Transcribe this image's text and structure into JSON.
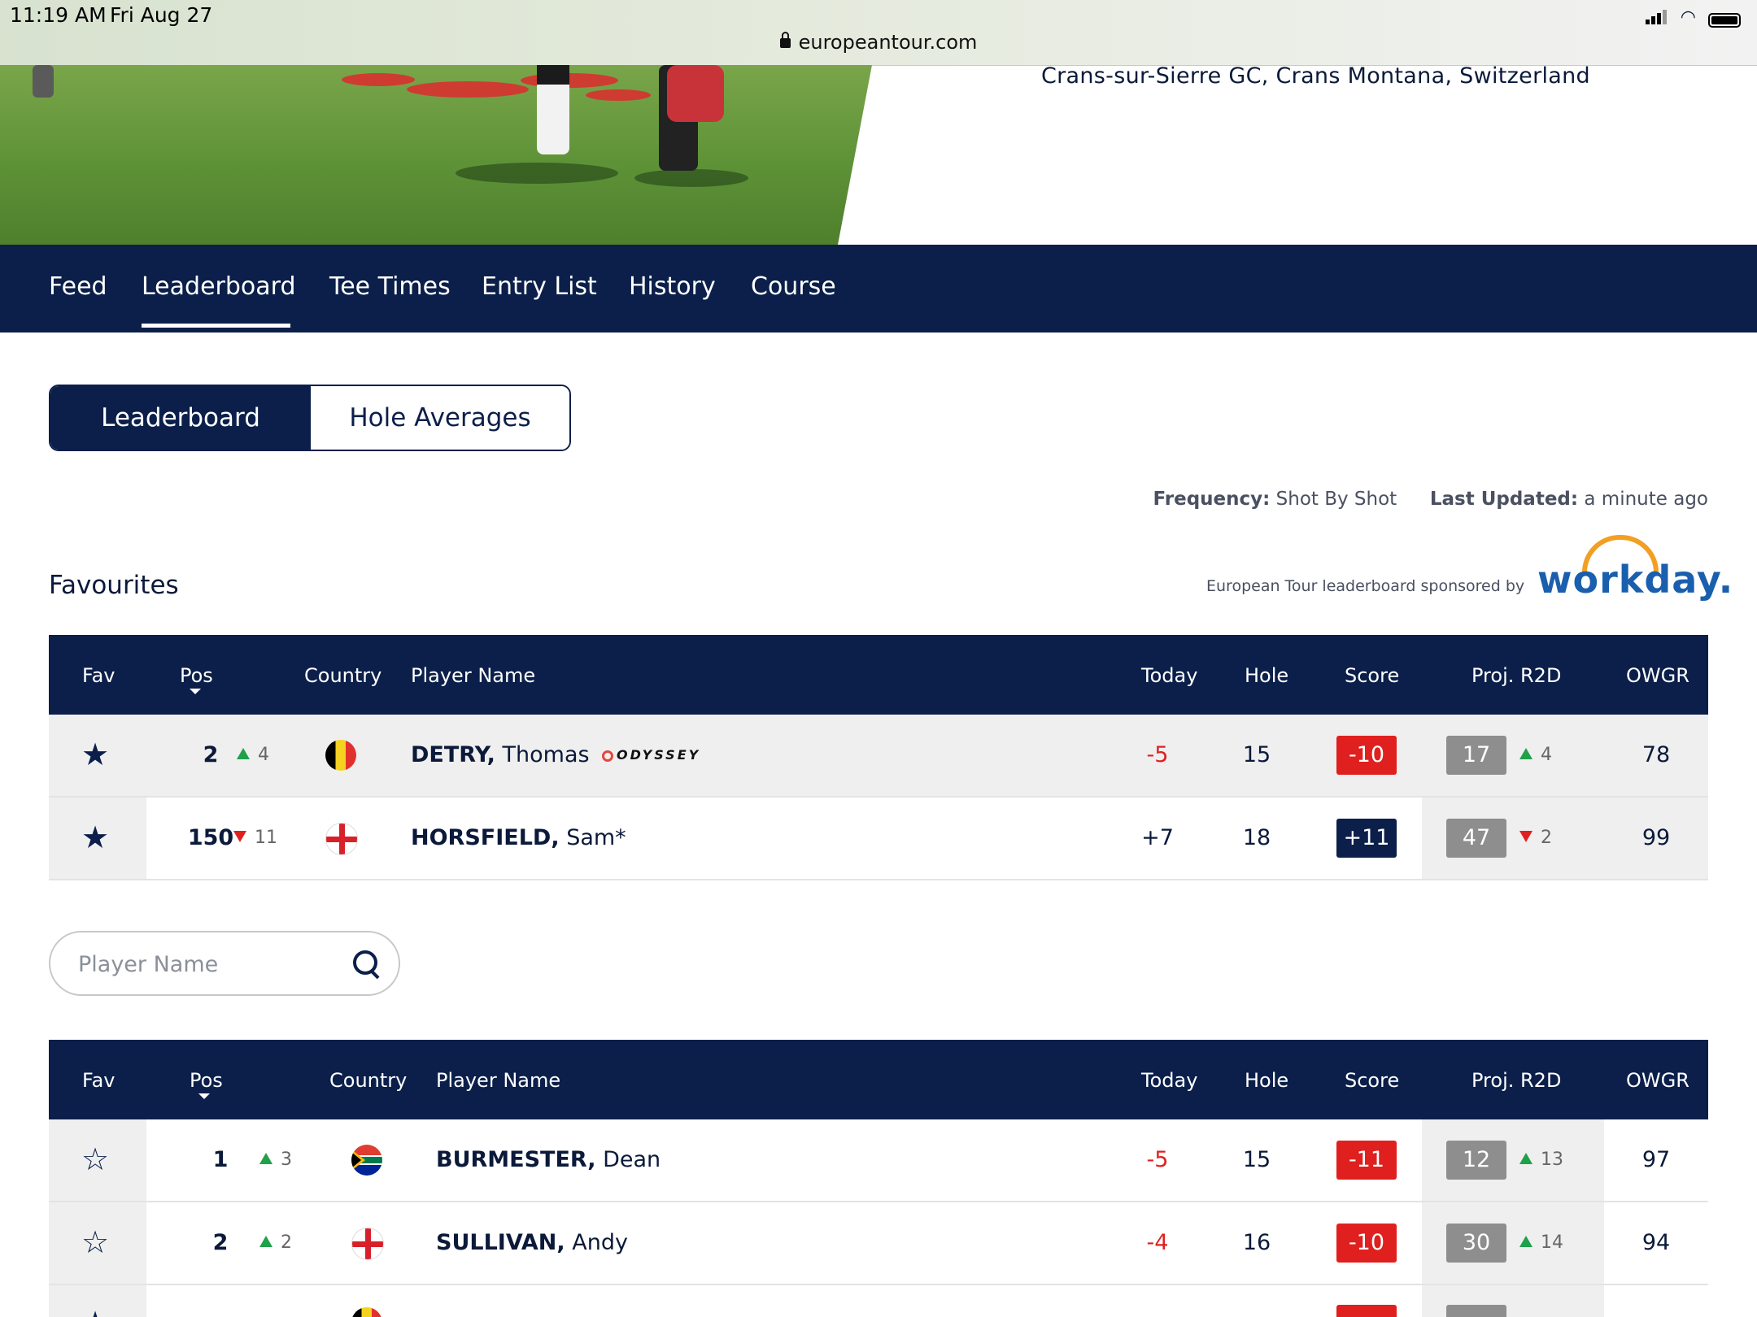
{
  "status_bar": {
    "time": "11:19 AM",
    "date": "Fri Aug 27",
    "url": "europeantour.com"
  },
  "event": {
    "venue": "Crans-sur-Sierre GC, Crans Montana, Switzerland"
  },
  "nav": {
    "tabs": [
      "Feed",
      "Leaderboard",
      "Tee Times",
      "Entry List",
      "History",
      "Course"
    ],
    "active": "Leaderboard"
  },
  "view_toggle": {
    "left": "Leaderboard",
    "right": "Hole Averages",
    "active": "Leaderboard"
  },
  "meta": {
    "frequency_label": "Frequency:",
    "frequency_value": "Shot By Shot",
    "updated_label": "Last Updated:",
    "updated_value": "a minute ago",
    "sponsor_text": "European Tour leaderboard sponsored by",
    "sponsor_logo": "workday."
  },
  "favourites_title": "Favourites",
  "columns": {
    "fav": "Fav",
    "pos": "Pos",
    "country": "Country",
    "player": "Player Name",
    "today": "Today",
    "hole": "Hole",
    "score": "Score",
    "proj": "Proj. R2D",
    "owgr": "OWGR"
  },
  "favourites": [
    {
      "fav": true,
      "pos": "2",
      "move_dir": "up",
      "move": "4",
      "country": "Belgium",
      "last": "DETRY,",
      "first": "Thomas",
      "sponsor": "ODYSSEY",
      "today": "-5",
      "hole": "15",
      "score": "-10",
      "proj": "17",
      "proj_dir": "up",
      "proj_move": "4",
      "owgr": "78"
    },
    {
      "fav": true,
      "pos": "150",
      "move_dir": "down",
      "move": "11",
      "country": "England",
      "last": "HORSFIELD,",
      "first": "Sam*",
      "sponsor": "",
      "today": "+7",
      "hole": "18",
      "score": "+11",
      "proj": "47",
      "proj_dir": "down",
      "proj_move": "2",
      "owgr": "99"
    }
  ],
  "search": {
    "placeholder": "Player Name"
  },
  "leaderboard": [
    {
      "fav": false,
      "pos": "1",
      "move_dir": "up",
      "move": "3",
      "country": "South Africa",
      "last": "BURMESTER,",
      "first": "Dean",
      "today": "-5",
      "hole": "15",
      "score": "-11",
      "proj": "12",
      "proj_dir": "up",
      "proj_move": "13",
      "owgr": "97"
    },
    {
      "fav": false,
      "pos": "2",
      "move_dir": "up",
      "move": "2",
      "country": "England",
      "last": "SULLIVAN,",
      "first": "Andy",
      "today": "-4",
      "hole": "16",
      "score": "-10",
      "proj": "30",
      "proj_dir": "up",
      "proj_move": "14",
      "owgr": "94"
    }
  ],
  "colors": {
    "navy": "#0b1f4a",
    "red": "#e0201e",
    "green": "#1fa14a",
    "grey_badge": "#8e8e8e",
    "workday_blue": "#1a5fad",
    "workday_orange": "#f29f24"
  }
}
